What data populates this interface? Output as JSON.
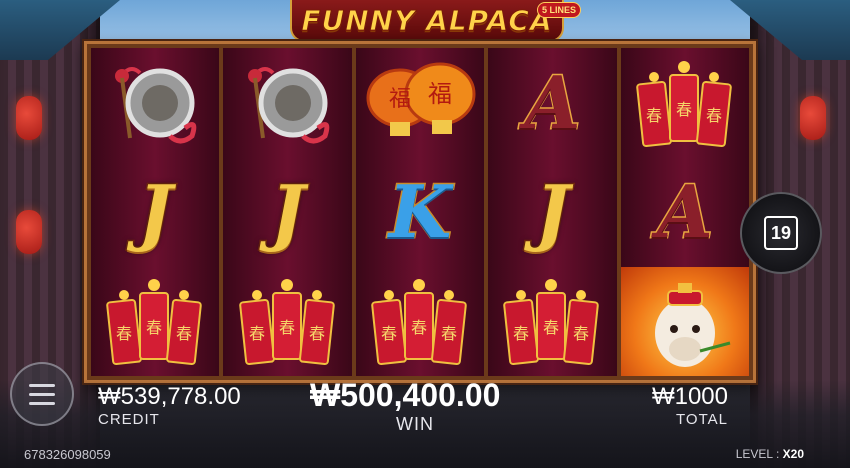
{
  "game": {
    "title": "FUNNY ALPACA",
    "lines_badge": "5 LINES"
  },
  "reels": [
    [
      "gong",
      "J",
      "firecrackers"
    ],
    [
      "gong",
      "J",
      "firecrackers"
    ],
    [
      "lanterns",
      "K",
      "firecrackers"
    ],
    [
      "A",
      "J",
      "firecrackers"
    ],
    [
      "firecrackers",
      "A",
      "alpaca-wild"
    ]
  ],
  "lantern_glyph": "福",
  "firecracker_glyph": "春",
  "stats": {
    "credit_value": "₩539,778.00",
    "credit_label": "CREDIT",
    "win_value": "₩500,400.00",
    "win_label": "WIN",
    "total_value": "₩1000",
    "total_label": "TOTAL"
  },
  "auto_spin_count": "19",
  "footer": {
    "player_id": "678326098059",
    "level_label": "LEVEL :",
    "level_value": "X20"
  },
  "colors": {
    "gold": "#f3c84a",
    "reel_bg": "#6a0f2e",
    "frame": "#b8743a"
  }
}
